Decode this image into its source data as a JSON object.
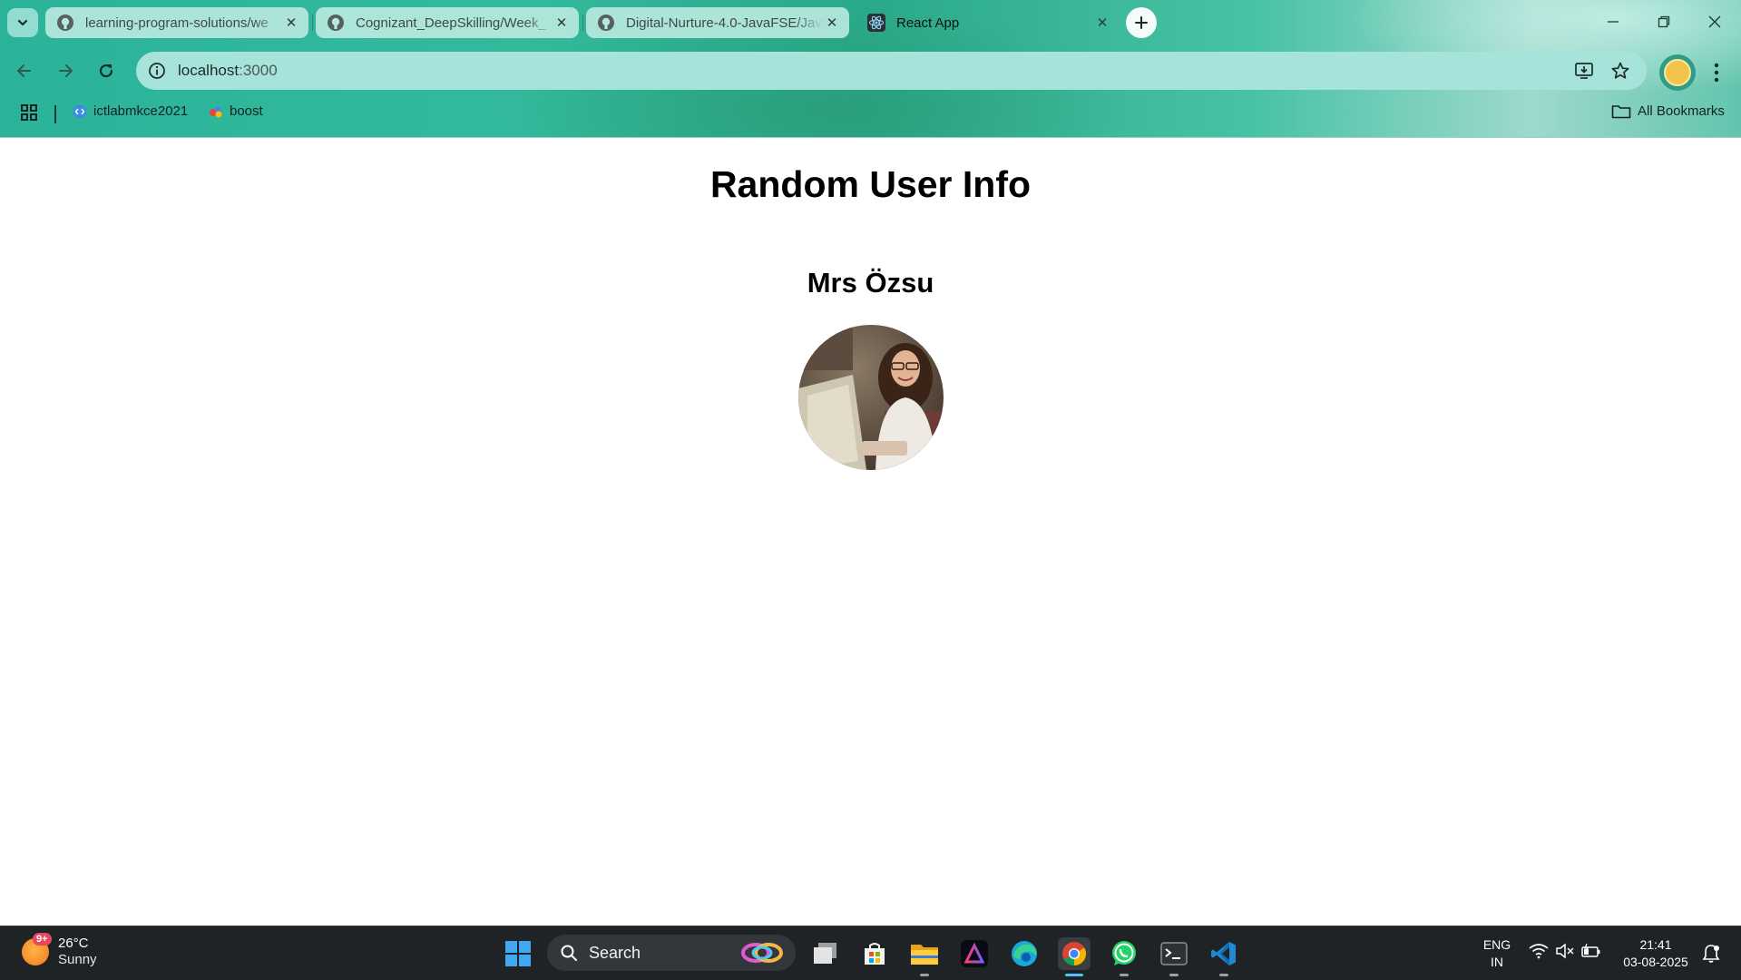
{
  "browser": {
    "tabs": [
      {
        "title": "learning-program-solutions/we",
        "favicon": "github-icon",
        "active": false
      },
      {
        "title": "Cognizant_DeepSkilling/Week_",
        "favicon": "github-icon",
        "active": false
      },
      {
        "title": "Digital-Nurture-4.0-JavaFSE/Jav",
        "favicon": "github-icon",
        "active": false
      },
      {
        "title": "React App",
        "favicon": "react-icon",
        "active": true
      }
    ],
    "address": {
      "host": "localhost",
      "port": ":3000"
    },
    "bookmarks": [
      {
        "label": "ictlabmkce2021",
        "icon": "code-icon"
      },
      {
        "label": "boost",
        "icon": "colored-dot-icon"
      }
    ],
    "all_bookmarks_label": "All Bookmarks"
  },
  "page": {
    "title": "Random User Info",
    "user": {
      "name": "Mrs Özsu",
      "photo_alt": "user-photo"
    }
  },
  "taskbar": {
    "weather": {
      "badge": "9+",
      "temp": "26°C",
      "condition": "Sunny"
    },
    "search_label": "Search",
    "language": {
      "line1": "ENG",
      "line2": "IN"
    },
    "clock": {
      "time": "21:41",
      "date": "03-08-2025"
    }
  }
}
